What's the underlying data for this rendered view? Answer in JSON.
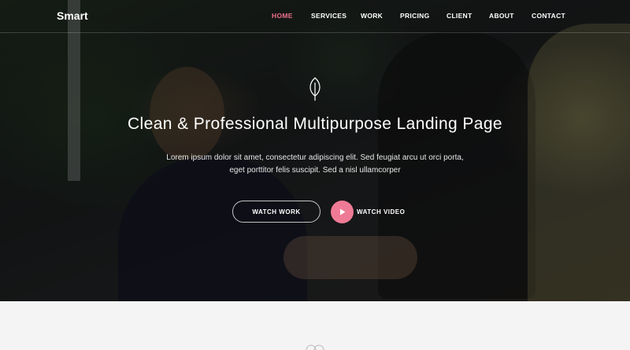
{
  "brand": {
    "name": "Smart"
  },
  "nav": {
    "items": [
      {
        "label": "HOME",
        "active": true
      },
      {
        "label": "SERVICES",
        "active": false
      },
      {
        "label": "WORK",
        "active": false
      },
      {
        "label": "PRICING",
        "active": false
      },
      {
        "label": "CLIENT",
        "active": false
      },
      {
        "label": "ABOUT",
        "active": false
      },
      {
        "label": "CONTACT",
        "active": false
      }
    ]
  },
  "hero": {
    "icon": "leaf-icon",
    "title": "Clean & Professional Multipurpose Landing Page",
    "subtitle_line1": "Lorem ipsum dolor sit amet, consectetur adipiscing elit. Sed feugiat arcu ut orci porta,",
    "subtitle_line2": "eget porttitor felis suscipit. Sed a nisl ullamcorper",
    "watch_work_label": "WATCH WORK",
    "watch_video_label": "WATCH VIDEO",
    "play_icon": "play-icon"
  },
  "colors": {
    "accent": "#ef6f8c",
    "play_button": "#ef7a96",
    "section_background": "#f4f4f5"
  }
}
